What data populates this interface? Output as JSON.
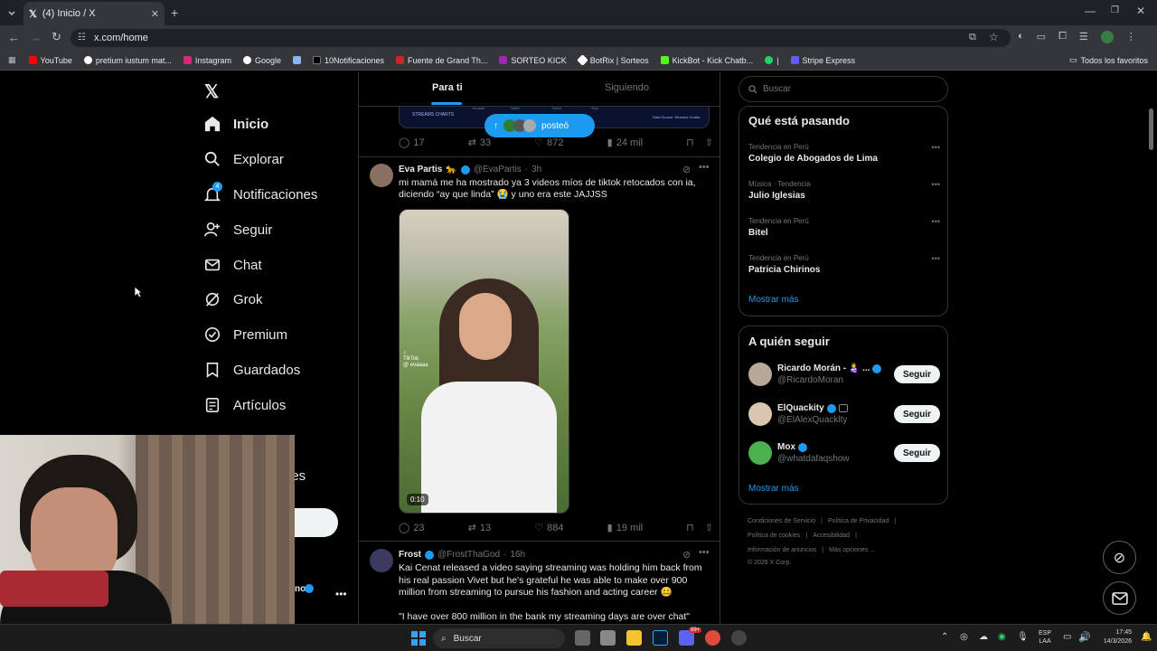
{
  "browser": {
    "tab_title": "(4) Inicio / X",
    "url": "x.com/home",
    "bookmarks": [
      "YouTube",
      "pretium iustum mat...",
      "Instagram",
      "Google",
      "",
      "10Notificaciones",
      "Fuente de Grand Th...",
      "SORTEO KICK",
      "BotRix | Sorteos",
      "KickBot - Kick Chatb...",
      "|",
      "Stripe Express"
    ],
    "all_bookmarks": "Todos los favoritos"
  },
  "nav": {
    "items": [
      "Inicio",
      "Explorar",
      "Notificaciones",
      "Seguir",
      "Chat",
      "Grok",
      "Premium",
      "Guardados",
      "Artículos"
    ],
    "badge": "4",
    "partial_label": "nes",
    "partial_handle": "no"
  },
  "feed": {
    "tab_foryou": "Para ti",
    "tab_following": "Siguiendo",
    "new_posts_pill": "posteó",
    "top_card": {
      "brand": "STREAMS CHARTS",
      "source": "Data Source: Streams Charts",
      "tabs": [
        "Youtube",
        "Twitch",
        "Twitch",
        "Kick"
      ]
    },
    "tweet0": {
      "replies": "17",
      "reposts": "33",
      "likes": "872",
      "views": "24 mil"
    },
    "tweet1": {
      "name": "Eva Partis",
      "emoji": "🐆",
      "handle": "@EvaPartis",
      "time": "3h",
      "text": "mi mamá me ha mostrado ya 3 videos míos de tiktok retocados con ia, diciendo “ay que linda” 😭 y uno era este JAJJSS",
      "watermark": "TikTok",
      "watermark_user": "@ evaaaa",
      "duration": "0:10",
      "replies": "23",
      "reposts": "13",
      "likes": "884",
      "views": "19 mil"
    },
    "tweet2": {
      "name": "Frost",
      "handle": "@FrostThaGod",
      "time": "16h",
      "text": "Kai Cenat released a video saying streaming was holding him back from his real passion Vivet but he's grateful he was able to make over 900 million from streaming to pursue his fashion and acting career 🤐",
      "quote": "\"I have over 800 million in the bank my streaming days are over chat\""
    }
  },
  "right": {
    "search_placeholder": "Buscar",
    "trending_title": "Qué está pasando",
    "trends": [
      {
        "meta": "Tendencia en Perú",
        "name": "Colegio de Abogados de Lima"
      },
      {
        "meta": "Música · Tendencia",
        "name": "Julio Iglesias"
      },
      {
        "meta": "Tendencia en Perú",
        "name": "Bitel"
      },
      {
        "meta": "Tendencia en Perú",
        "name": "Patricia Chirinos"
      }
    ],
    "show_more": "Mostrar más",
    "follow_title": "A quién seguir",
    "follow": [
      {
        "name": "Ricardo Morán - 👩‍🍼 ...",
        "handle": "@RicardoMoran",
        "button": "Seguir"
      },
      {
        "name": "ElQuackity",
        "handle": "@ElAlexQuacklty",
        "button": "Seguir"
      },
      {
        "name": "Mox",
        "handle": "@whatdafaqshow",
        "button": "Seguir"
      }
    ],
    "show_more2": "Mostrar más",
    "footer": [
      "Condiciones de Servicio",
      "|",
      "Política de Privacidad",
      "|",
      "Política de cookies",
      "|",
      "Accesibilidad",
      "|",
      "Información de anuncios",
      "|",
      "Más opciones ...",
      "© 2026 X Corp."
    ]
  },
  "taskbar": {
    "search": "Buscar",
    "lang": "ESP",
    "lang2": "LAA",
    "time": "17:45",
    "date": "14/3/2026",
    "badge": "99+"
  },
  "colors": {
    "accent": "#1d9bf0",
    "verified": "#1d9bf0",
    "pill": "#1d9bf0"
  }
}
